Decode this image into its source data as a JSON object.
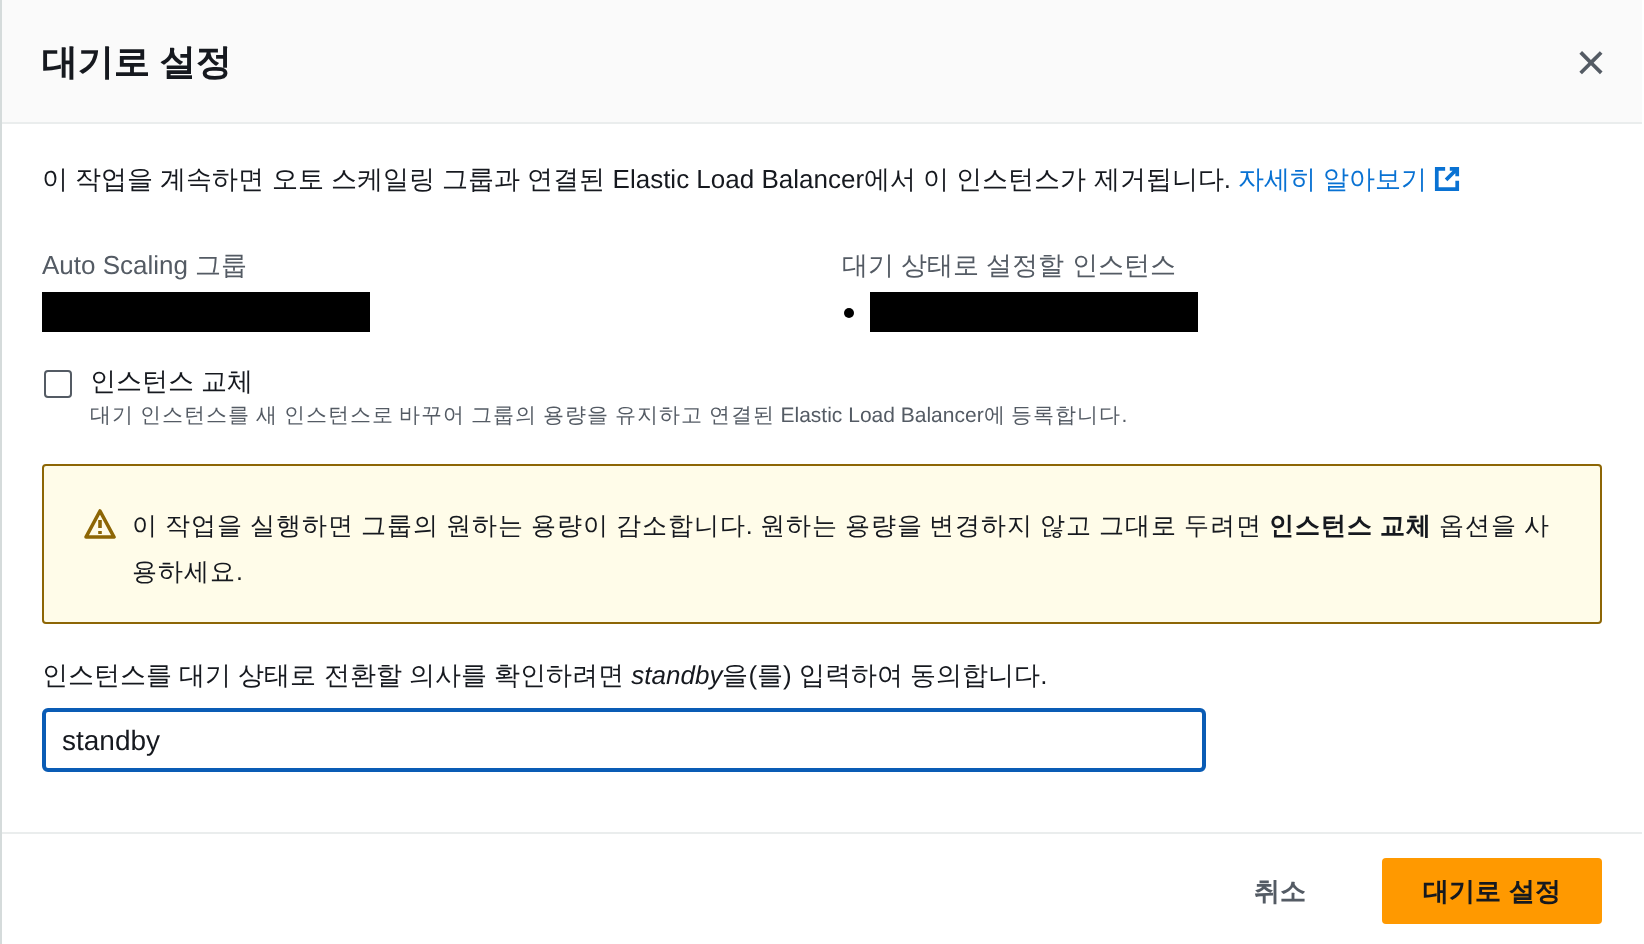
{
  "dialog": {
    "title": "대기로 설정",
    "close": "×"
  },
  "intro": {
    "text": "이 작업을 계속하면 오토 스케일링 그룹과 연결된 Elastic Load Balancer에서 이 인스턴스가 제거됩니다.",
    "link": "자세히 알아보기"
  },
  "fields": [
    {
      "label": "Auto Scaling 그룹",
      "redacted": true,
      "bullet": false
    },
    {
      "label": "대기 상태로 설정할 인스턴스",
      "redacted": true,
      "bullet": true
    }
  ],
  "replace_option": {
    "label": "인스턴스 교체",
    "checked": false,
    "description": "대기 인스턴스를 새 인스턴스로 바꾸어 그룹의 용량을 유지하고 연결된 Elastic Load Balancer에 등록합니다."
  },
  "warning": {
    "text": "이 작업을 실행하면 그룹의 원하는 용량이 감소합니다. 원하는 용량을 변경하지 않고 그대로 두려면 **인스턴스 교체** 옵션을 사용하세요."
  },
  "confirm": {
    "prompt_before": "인스턴스를 대기 상태로 전환할 의사를 확인하려면 ",
    "keyword": "standby",
    "prompt_after": "을(를) 입력하여 동의합니다.",
    "value": "standby"
  },
  "buttons": [
    {
      "label": "취소",
      "kind": "link"
    },
    {
      "label": "대기로 설정",
      "kind": "primary"
    }
  ]
}
